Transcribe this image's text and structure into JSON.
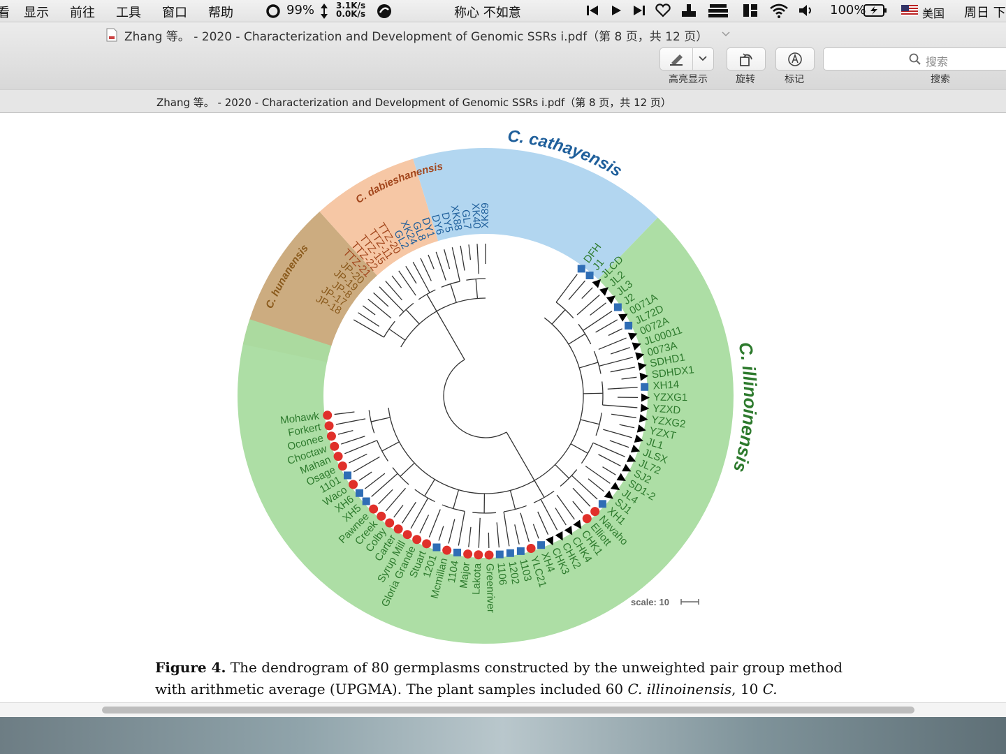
{
  "menubar": {
    "partial_item": "看",
    "items": [
      "显示",
      "前往",
      "工具",
      "窗口",
      "帮助"
    ],
    "cpu": "99%",
    "net_up": "3.1K/s",
    "net_down": "0.0K/s",
    "song": "称心 不如意",
    "battery": "100%",
    "input_source": "美国",
    "clock": "周日 下"
  },
  "window": {
    "title": "Zhang 等。 - 2020 - Characterization and Development of Genomic SSRs i.pdf（第 8 页，共 12 页）",
    "subtitle": "Zhang 等。 - 2020 - Characterization and Development of Genomic SSRs i.pdf（第 8 页，共 12 页）",
    "toolbar": {
      "highlight_label": "高亮显示",
      "rotate_label": "旋转",
      "markup_label": "标记",
      "search_placeholder": "搜索",
      "search_label": "搜索"
    }
  },
  "figure": {
    "groups": [
      {
        "name": "C. hunanensis",
        "color": "#c9a879",
        "text_color": "#8a5a1c"
      },
      {
        "name": "C. dabieshanensis",
        "color": "#f6c4a0",
        "text_color": "#a2461c"
      },
      {
        "name": "C. cathayensis",
        "color": "#aed4ef",
        "text_color": "#1f5f9b"
      },
      {
        "name": "C. illinoinensis",
        "color": "#a9dca0",
        "text_color": "#2d7a2d"
      }
    ],
    "leaves": [
      {
        "label": "DFH",
        "marker": "square"
      },
      {
        "label": "J1",
        "marker": "square"
      },
      {
        "label": "JLCD",
        "marker": "triangle"
      },
      {
        "label": "JL2",
        "marker": "triangle"
      },
      {
        "label": "JL3",
        "marker": "triangle"
      },
      {
        "label": "J2",
        "marker": "square"
      },
      {
        "label": "0071A",
        "marker": "triangle"
      },
      {
        "label": "JL72D",
        "marker": "square"
      },
      {
        "label": "0072A",
        "marker": "triangle"
      },
      {
        "label": "JL00011",
        "marker": "triangle"
      },
      {
        "label": "0073A",
        "marker": "triangle"
      },
      {
        "label": "SDHD1",
        "marker": "triangle"
      },
      {
        "label": "SDHDX1",
        "marker": "triangle"
      },
      {
        "label": "XH14",
        "marker": "square"
      },
      {
        "label": "YZXG1",
        "marker": "triangle"
      },
      {
        "label": "YZXD",
        "marker": "triangle"
      },
      {
        "label": "YZXG2",
        "marker": "triangle"
      },
      {
        "label": "YZXT",
        "marker": "triangle"
      },
      {
        "label": "JL1",
        "marker": "triangle"
      },
      {
        "label": "JLSX",
        "marker": "triangle"
      },
      {
        "label": "JL72",
        "marker": "triangle"
      },
      {
        "label": "SJ2",
        "marker": "triangle"
      },
      {
        "label": "SD1-2",
        "marker": "triangle"
      },
      {
        "label": "JL4",
        "marker": "triangle"
      },
      {
        "label": "SJ1",
        "marker": "triangle"
      },
      {
        "label": "XH1",
        "marker": "square"
      },
      {
        "label": "Navaho",
        "marker": "circle"
      },
      {
        "label": "Elliott",
        "marker": "circle"
      },
      {
        "label": "CHK1",
        "marker": "triangle"
      },
      {
        "label": "CHK4",
        "marker": "triangle"
      },
      {
        "label": "CHK2",
        "marker": "triangle"
      },
      {
        "label": "CHK3",
        "marker": "triangle"
      },
      {
        "label": "XH4",
        "marker": "square"
      },
      {
        "label": "YLC21",
        "marker": "circle"
      },
      {
        "label": "1103",
        "marker": "square"
      },
      {
        "label": "1202",
        "marker": "square"
      },
      {
        "label": "1106",
        "marker": "square"
      },
      {
        "label": "Greenriver",
        "marker": "circle"
      },
      {
        "label": "Lakota",
        "marker": "circle"
      },
      {
        "label": "Major",
        "marker": "circle"
      },
      {
        "label": "1104",
        "marker": "square"
      },
      {
        "label": "Mcmillan",
        "marker": "circle"
      },
      {
        "label": "1201",
        "marker": "square"
      },
      {
        "label": "Stuart",
        "marker": "circle"
      },
      {
        "label": "Gloria Grande",
        "marker": "circle"
      },
      {
        "label": "Syrup Mill",
        "marker": "circle"
      },
      {
        "label": "Carter",
        "marker": "circle"
      },
      {
        "label": "Colby",
        "marker": "circle"
      },
      {
        "label": "Creek",
        "marker": "circle"
      },
      {
        "label": "Pawnee",
        "marker": "circle"
      },
      {
        "label": "XH5",
        "marker": "square"
      },
      {
        "label": "XH6",
        "marker": "square"
      },
      {
        "label": "Waco",
        "marker": "circle"
      },
      {
        "label": "1101",
        "marker": "square"
      },
      {
        "label": "Osage",
        "marker": "circle"
      },
      {
        "label": "Mahan",
        "marker": "circle"
      },
      {
        "label": "Choctaw",
        "marker": "circle"
      },
      {
        "label": "Oconee",
        "marker": "circle"
      },
      {
        "label": "Forkert",
        "marker": "circle"
      },
      {
        "label": "Mohawk",
        "marker": "circle"
      },
      {
        "label": "JP-18",
        "marker": "none"
      },
      {
        "label": "JP-17",
        "marker": "none"
      },
      {
        "label": "JP-8",
        "marker": "none"
      },
      {
        "label": "JP-19",
        "marker": "none"
      },
      {
        "label": "JP-20",
        "marker": "none"
      },
      {
        "label": "TTZ-21",
        "marker": "none"
      },
      {
        "label": "TTZ-22",
        "marker": "none"
      },
      {
        "label": "TTZ-15",
        "marker": "none"
      },
      {
        "label": "TTZ-11",
        "marker": "none"
      },
      {
        "label": "TTZ-20",
        "marker": "none"
      },
      {
        "label": "GL2",
        "marker": "none"
      },
      {
        "label": "XK24",
        "marker": "none"
      },
      {
        "label": "GL8",
        "marker": "none"
      },
      {
        "label": "DY1",
        "marker": "none"
      },
      {
        "label": "DY6",
        "marker": "none"
      },
      {
        "label": "DY5",
        "marker": "none"
      },
      {
        "label": "XK88",
        "marker": "none"
      },
      {
        "label": "GL7",
        "marker": "none"
      },
      {
        "label": "XK40",
        "marker": "none"
      },
      {
        "label": "XK89",
        "marker": "none"
      }
    ],
    "marker_colors": {
      "circle": "#e0302a",
      "square": "#2f6db5",
      "triangle": "#000000"
    },
    "scale_label": "scale: 10"
  },
  "caption": {
    "label": "Figure 4.",
    "text": "The dendrogram of 80 germplasms constructed by the unweighted pair group method with arithmetic average (UPGMA). The plant samples included 60 ",
    "i1": "C. illinoinensis",
    "mid": ", 10 ",
    "i2": "C. cathayensis",
    "end": ","
  }
}
